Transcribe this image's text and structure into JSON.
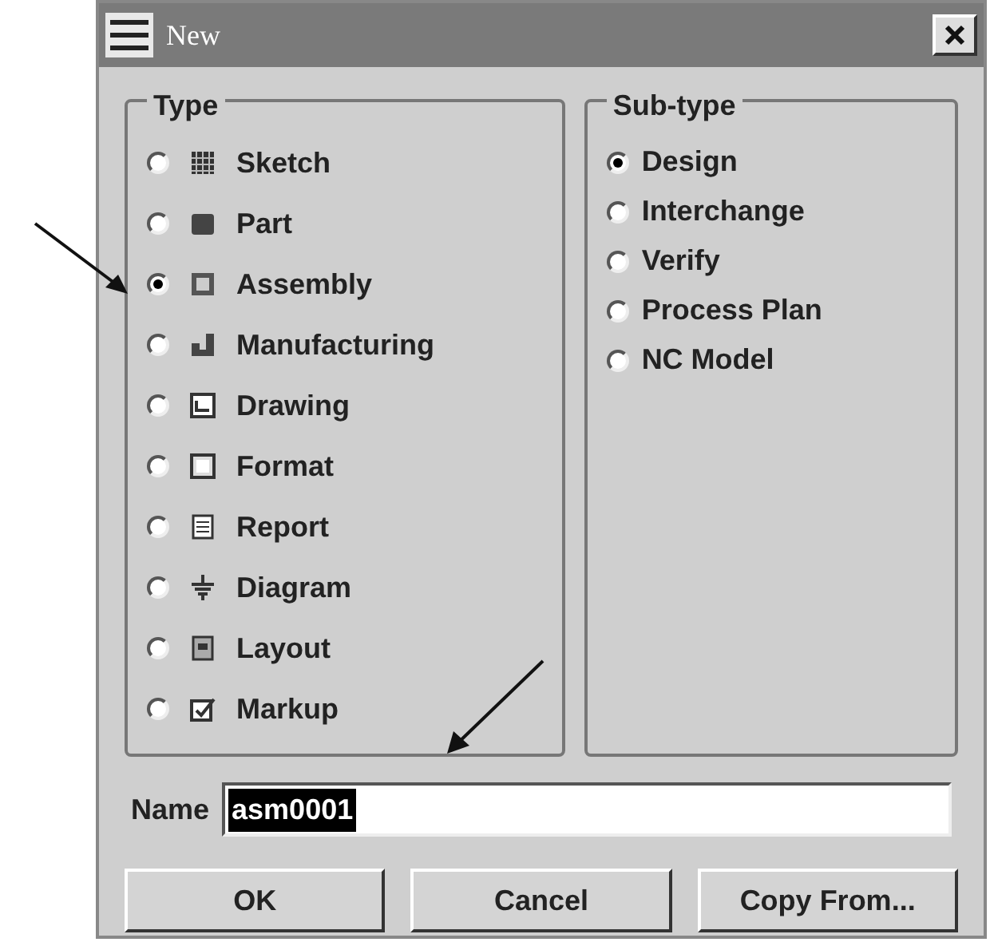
{
  "window": {
    "title": "New"
  },
  "type_group": {
    "label": "Type",
    "items": [
      {
        "label": "Sketch",
        "selected": false
      },
      {
        "label": "Part",
        "selected": false
      },
      {
        "label": "Assembly",
        "selected": true
      },
      {
        "label": "Manufacturing",
        "selected": false
      },
      {
        "label": "Drawing",
        "selected": false
      },
      {
        "label": "Format",
        "selected": false
      },
      {
        "label": "Report",
        "selected": false
      },
      {
        "label": "Diagram",
        "selected": false
      },
      {
        "label": "Layout",
        "selected": false
      },
      {
        "label": "Markup",
        "selected": false
      }
    ]
  },
  "subtype_group": {
    "label": "Sub-type",
    "items": [
      {
        "label": "Design",
        "selected": true
      },
      {
        "label": "Interchange",
        "selected": false
      },
      {
        "label": "Verify",
        "selected": false
      },
      {
        "label": "Process Plan",
        "selected": false
      },
      {
        "label": "NC Model",
        "selected": false
      }
    ]
  },
  "name": {
    "label": "Name",
    "value": "asm0001"
  },
  "buttons": [
    "OK",
    "Cancel",
    "Copy From..."
  ]
}
